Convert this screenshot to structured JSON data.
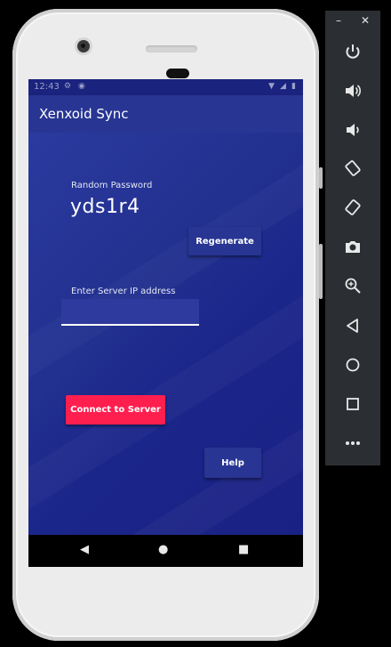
{
  "device": {
    "status_time": "12:43"
  },
  "app": {
    "title": "Xenxoid Sync",
    "password_label": "Random Password",
    "password_value": "yds1r4",
    "regenerate_label": "Regenerate",
    "ip_label": "Enter Server IP address",
    "ip_value": "",
    "connect_label": "Connect to Server",
    "help_label": "Help",
    "colors": {
      "app_bar": "#283593",
      "background": "#1e2a86",
      "accent": "#ff1f4f"
    }
  },
  "navbar": {
    "icons": [
      "back-icon",
      "home-icon",
      "recents-icon"
    ]
  },
  "emulator_toolbar": {
    "window_controls": [
      "minimize-icon",
      "close-icon"
    ],
    "tools": [
      "power-icon",
      "volume-up-icon",
      "volume-down-icon",
      "rotate-left-icon",
      "rotate-right-icon",
      "camera-icon",
      "zoom-icon",
      "back-icon",
      "home-icon",
      "overview-icon",
      "more-icon"
    ]
  }
}
